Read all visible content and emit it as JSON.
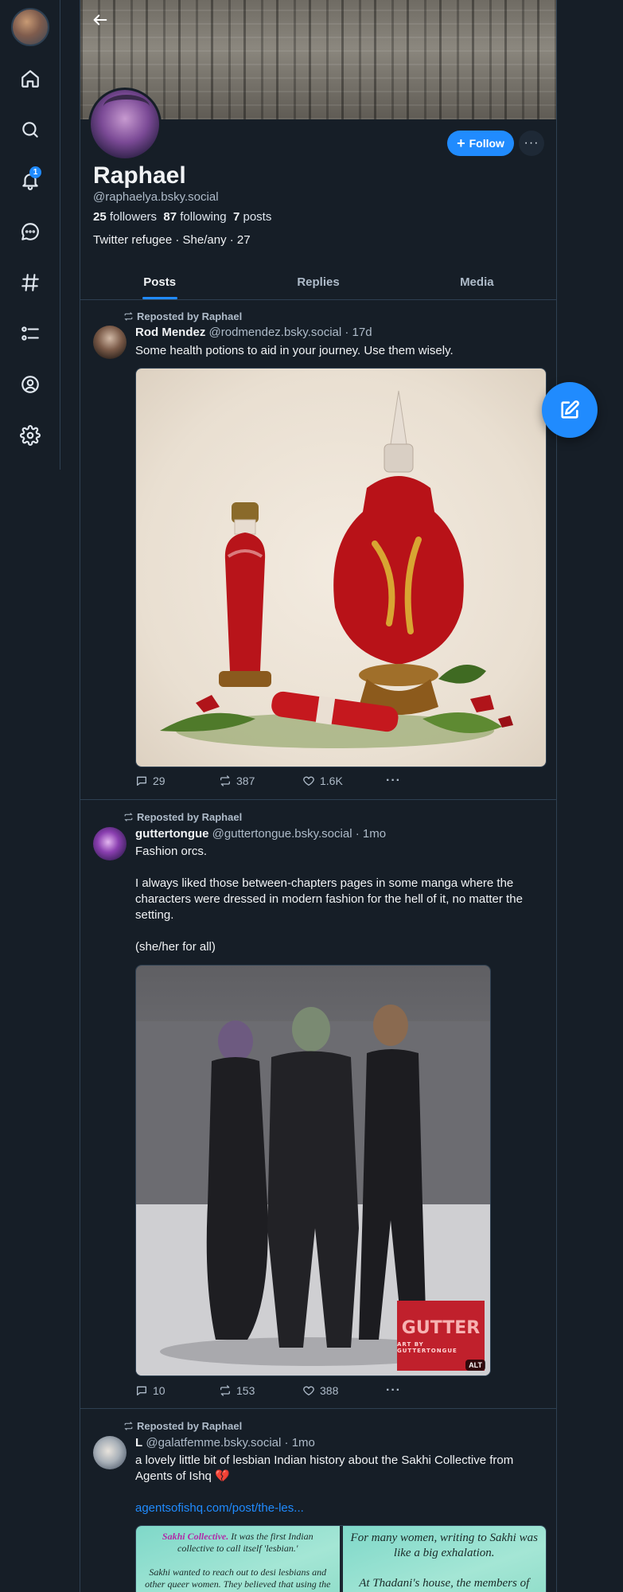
{
  "nav": {
    "notification_count": "1",
    "items": [
      "home",
      "search",
      "notifications",
      "chat",
      "feeds",
      "lists",
      "profile",
      "settings"
    ]
  },
  "profile": {
    "display_name": "Raphael",
    "handle": "@raphaelya.bsky.social",
    "followers_count": "25",
    "followers_label": "followers",
    "following_count": "87",
    "following_label": "following",
    "posts_count": "7",
    "posts_label": "posts",
    "bio": "Twitter refugee · She/any · 27",
    "follow_label": "Follow",
    "more_label": "···"
  },
  "tabs": [
    {
      "label": "Posts",
      "active": true
    },
    {
      "label": "Replies",
      "active": false
    },
    {
      "label": "Media",
      "active": false
    }
  ],
  "posts": [
    {
      "repost_label": "Reposted by Raphael",
      "author": "Rod Mendez",
      "handle": "@rodmendez.bsky.social",
      "time": "· 17d",
      "text": [
        "Some health potions to aid in your journey. Use them wisely."
      ],
      "replies": "29",
      "reposts": "387",
      "likes": "1.6K",
      "more": "···"
    },
    {
      "repost_label": "Reposted by Raphael",
      "author": "guttertongue",
      "handle": "@guttertongue.bsky.social",
      "time": "· 1mo",
      "text": [
        "Fashion orcs.",
        "",
        "I always liked those between-chapters pages in some manga where the characters were dressed in modern fashion for the hell of it, no matter the setting.",
        "",
        "(she/her for all)"
      ],
      "image_watermark": "GUTTER",
      "image_watermark_sub": "ART BY GUTTERTONGUE",
      "alt_badge": "ALT",
      "replies": "10",
      "reposts": "153",
      "likes": "388",
      "more": "···"
    },
    {
      "repost_label": "Reposted by Raphael",
      "author": "L",
      "handle": "@galatfemme.bsky.social",
      "time": "· 1mo",
      "text": [
        "a lovely little bit of lesbian Indian history about the Sakhi Collective from Agents of Ishq 💔"
      ],
      "link": "agentsofishq.com/post/the-les...",
      "comic_left_hl": "Sakhi Collective.",
      "comic_left_1": "It was the first Indian collective to call itself 'lesbian.'",
      "comic_left_2": "Sakhi wanted to reach out to desi lesbians and other queer women. They believed that using the term",
      "comic_right_1": "For many women, writing to Sakhi was like a big exhalation.",
      "comic_right_2": "At Thadani's house, the members of Sakhi personally read"
    }
  ],
  "colors": {
    "background": "#161e27",
    "accent": "#208bfe",
    "border": "#2e4052",
    "muted_text": "#aebbc9"
  }
}
